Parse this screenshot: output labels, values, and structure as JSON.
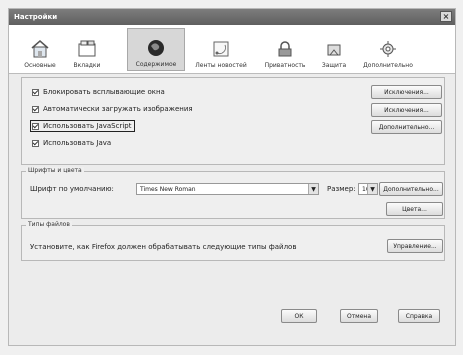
{
  "window": {
    "title": "Настройки"
  },
  "tabs": [
    {
      "label": "Основные",
      "icon": "house-icon"
    },
    {
      "label": "Вкладки",
      "icon": "tabs-icon"
    },
    {
      "label": "Содержимое",
      "icon": "globe-icon",
      "selected": true
    },
    {
      "label": "Ленты новостей",
      "icon": "feeds-icon"
    },
    {
      "label": "Приватность",
      "icon": "privacy-icon"
    },
    {
      "label": "Защита",
      "icon": "lock-icon"
    },
    {
      "label": "Дополнительно",
      "icon": "gear-icon"
    }
  ],
  "content": {
    "checks": [
      {
        "label": "Блокировать всплывающие окна",
        "checked": true
      },
      {
        "label": "Автоматически загружать изображения",
        "checked": true
      },
      {
        "label": "Использовать JavaScript",
        "checked": true
      },
      {
        "label": "Использовать Java",
        "checked": true
      }
    ],
    "buttons": [
      "Исключения...",
      "Исключения...",
      "Дополнительно..."
    ],
    "fonts_group": {
      "title": "Шрифты и цвета",
      "default_font_label": "Шрифт по умолчанию:",
      "default_font_value": "Times New Roman",
      "size_label": "Размер:",
      "size_value": "16",
      "advanced_button": "Дополнительно...",
      "colors_button": "Цвета..."
    },
    "file_types_group": {
      "title": "Типы файлов",
      "description": "Установите, как Firefox должен обрабатывать следующие типы файлов",
      "manage_button": "Управление..."
    }
  },
  "footer": {
    "ok": "ОК",
    "cancel": "Отмена",
    "help": "Справка"
  }
}
